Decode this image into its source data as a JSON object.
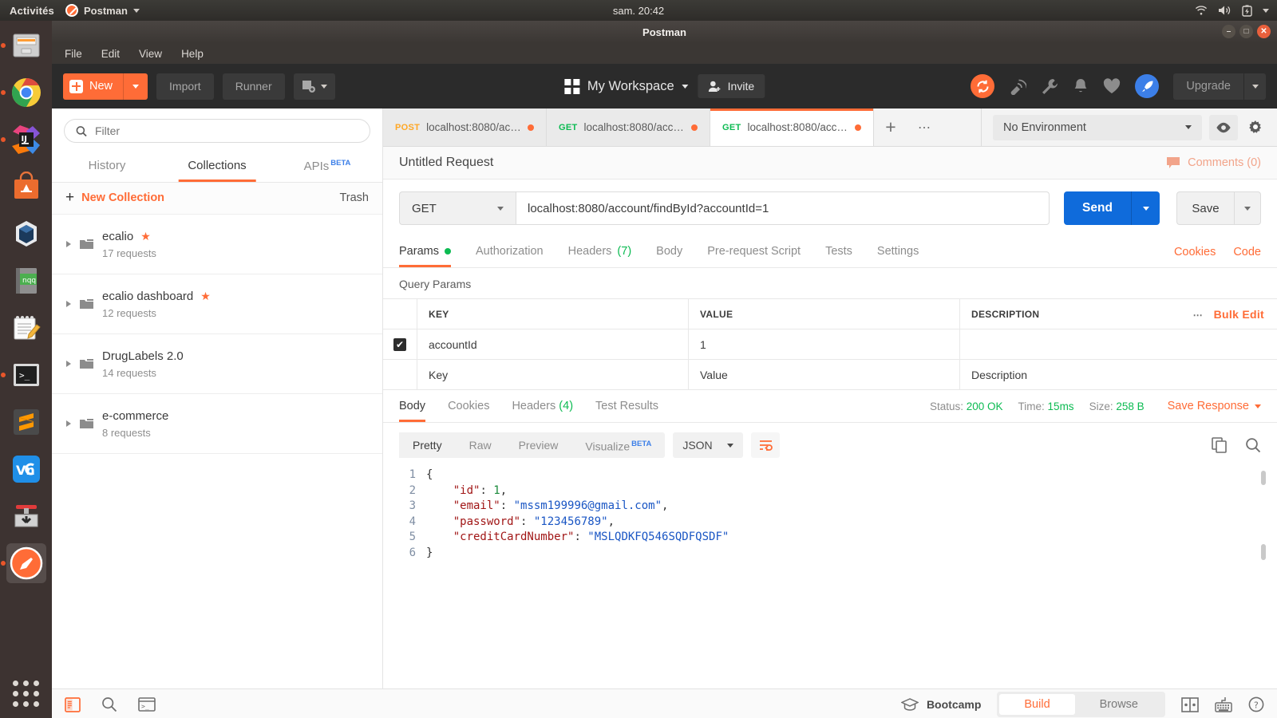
{
  "desktop": {
    "activities": "Activités",
    "app_menu": "Postman",
    "clock": "sam. 20:42",
    "dock_items": [
      {
        "name": "files",
        "label": "Files"
      },
      {
        "name": "chrome",
        "label": "Google Chrome"
      },
      {
        "name": "intellij",
        "label": "IntelliJ IDEA"
      },
      {
        "name": "ubuntu-software",
        "label": "Ubuntu Software"
      },
      {
        "name": "virtualbox",
        "label": "VirtualBox"
      },
      {
        "name": "notepadqq",
        "label": "nqq"
      },
      {
        "name": "text-editor",
        "label": "Text Editor"
      },
      {
        "name": "terminal",
        "label": "Terminal"
      },
      {
        "name": "sublime",
        "label": "Sublime Text"
      },
      {
        "name": "vnc",
        "label": "VNC Viewer"
      },
      {
        "name": "installer",
        "label": "Install Ubuntu"
      },
      {
        "name": "postman",
        "label": "Postman"
      }
    ]
  },
  "window": {
    "title": "Postman"
  },
  "menubar": [
    "File",
    "Edit",
    "View",
    "Help"
  ],
  "toolbar": {
    "new_label": "New",
    "import_label": "Import",
    "runner_label": "Runner",
    "workspace_name": "My Workspace",
    "invite_label": "Invite",
    "upgrade_label": "Upgrade"
  },
  "sidebar": {
    "filter_placeholder": "Filter",
    "tabs": [
      {
        "label": "History",
        "active": false,
        "beta": false
      },
      {
        "label": "Collections",
        "active": true,
        "beta": false
      },
      {
        "label": "APIs",
        "active": false,
        "beta": true,
        "beta_label": "BETA"
      }
    ],
    "new_collection_label": "New Collection",
    "trash_label": "Trash",
    "collections": [
      {
        "name": "ecalio",
        "count": "17 requests",
        "starred": true
      },
      {
        "name": "ecalio dashboard",
        "count": "12 requests",
        "starred": true
      },
      {
        "name": "DrugLabels 2.0",
        "count": "14 requests",
        "starred": false
      },
      {
        "name": "e-commerce",
        "count": "8 requests",
        "starred": false
      }
    ]
  },
  "request_tabs": [
    {
      "method": "POST",
      "url": "localhost:8080/acc...",
      "active": false,
      "unsaved": true
    },
    {
      "method": "GET",
      "url": "localhost:8080/acco...",
      "active": false,
      "unsaved": true
    },
    {
      "method": "GET",
      "url": "localhost:8080/acco...",
      "active": true,
      "unsaved": true
    }
  ],
  "environment": {
    "selected": "No Environment"
  },
  "request": {
    "title": "Untitled Request",
    "comments_label": "Comments (0)",
    "method": "GET",
    "url": "localhost:8080/account/findById?accountId=1",
    "send_label": "Send",
    "save_label": "Save",
    "tabs": [
      {
        "label": "Params",
        "active": true,
        "dot": true
      },
      {
        "label": "Authorization",
        "active": false
      },
      {
        "label": "Headers",
        "active": false,
        "count": "(7)"
      },
      {
        "label": "Body",
        "active": false
      },
      {
        "label": "Pre-request Script",
        "active": false
      },
      {
        "label": "Tests",
        "active": false
      },
      {
        "label": "Settings",
        "active": false
      }
    ],
    "cookies_label": "Cookies",
    "code_label": "Code",
    "query_params_label": "Query Params",
    "table": {
      "headers": [
        "KEY",
        "VALUE",
        "DESCRIPTION"
      ],
      "bulk_edit_label": "Bulk Edit",
      "rows": [
        {
          "checked": true,
          "key": "accountId",
          "value": "1",
          "description": ""
        }
      ],
      "placeholder_row": {
        "key": "Key",
        "value": "Value",
        "description": "Description"
      }
    }
  },
  "response": {
    "tabs": [
      {
        "label": "Body",
        "active": true
      },
      {
        "label": "Cookies",
        "active": false
      },
      {
        "label": "Headers",
        "active": false,
        "count": "(4)"
      },
      {
        "label": "Test Results",
        "active": false
      }
    ],
    "status_label": "Status:",
    "status_value": "200 OK",
    "time_label": "Time:",
    "time_value": "15ms",
    "size_label": "Size:",
    "size_value": "258 B",
    "save_response_label": "Save Response",
    "view_modes": [
      {
        "label": "Pretty",
        "active": true
      },
      {
        "label": "Raw",
        "active": false
      },
      {
        "label": "Preview",
        "active": false
      },
      {
        "label": "Visualize",
        "active": false,
        "beta": "BETA"
      }
    ],
    "format": "JSON",
    "body_lines": [
      {
        "n": "1",
        "tokens": [
          {
            "t": "{",
            "c": "p"
          }
        ]
      },
      {
        "n": "2",
        "tokens": [
          {
            "t": "    ",
            "c": "p"
          },
          {
            "t": "\"id\"",
            "c": "k"
          },
          {
            "t": ": ",
            "c": "p"
          },
          {
            "t": "1",
            "c": "n"
          },
          {
            "t": ",",
            "c": "p"
          }
        ]
      },
      {
        "n": "3",
        "tokens": [
          {
            "t": "    ",
            "c": "p"
          },
          {
            "t": "\"email\"",
            "c": "k"
          },
          {
            "t": ": ",
            "c": "p"
          },
          {
            "t": "\"mssm199996@gmail.com\"",
            "c": "s"
          },
          {
            "t": ",",
            "c": "p"
          }
        ]
      },
      {
        "n": "4",
        "tokens": [
          {
            "t": "    ",
            "c": "p"
          },
          {
            "t": "\"password\"",
            "c": "k"
          },
          {
            "t": ": ",
            "c": "p"
          },
          {
            "t": "\"123456789\"",
            "c": "s"
          },
          {
            "t": ",",
            "c": "p"
          }
        ]
      },
      {
        "n": "5",
        "tokens": [
          {
            "t": "    ",
            "c": "p"
          },
          {
            "t": "\"creditCardNumber\"",
            "c": "k"
          },
          {
            "t": ": ",
            "c": "p"
          },
          {
            "t": "\"MSLQDKFQ546SQDFQSDF\"",
            "c": "s"
          }
        ]
      },
      {
        "n": "6",
        "tokens": [
          {
            "t": "}",
            "c": "p"
          }
        ]
      }
    ]
  },
  "statusbar": {
    "bootcamp_label": "Bootcamp",
    "build_label": "Build",
    "browse_label": "Browse"
  },
  "colors": {
    "accent": "#ff6c37",
    "send_blue": "#0f6bdb",
    "success_green": "#0cbb52",
    "post_orange": "#ffa724"
  }
}
